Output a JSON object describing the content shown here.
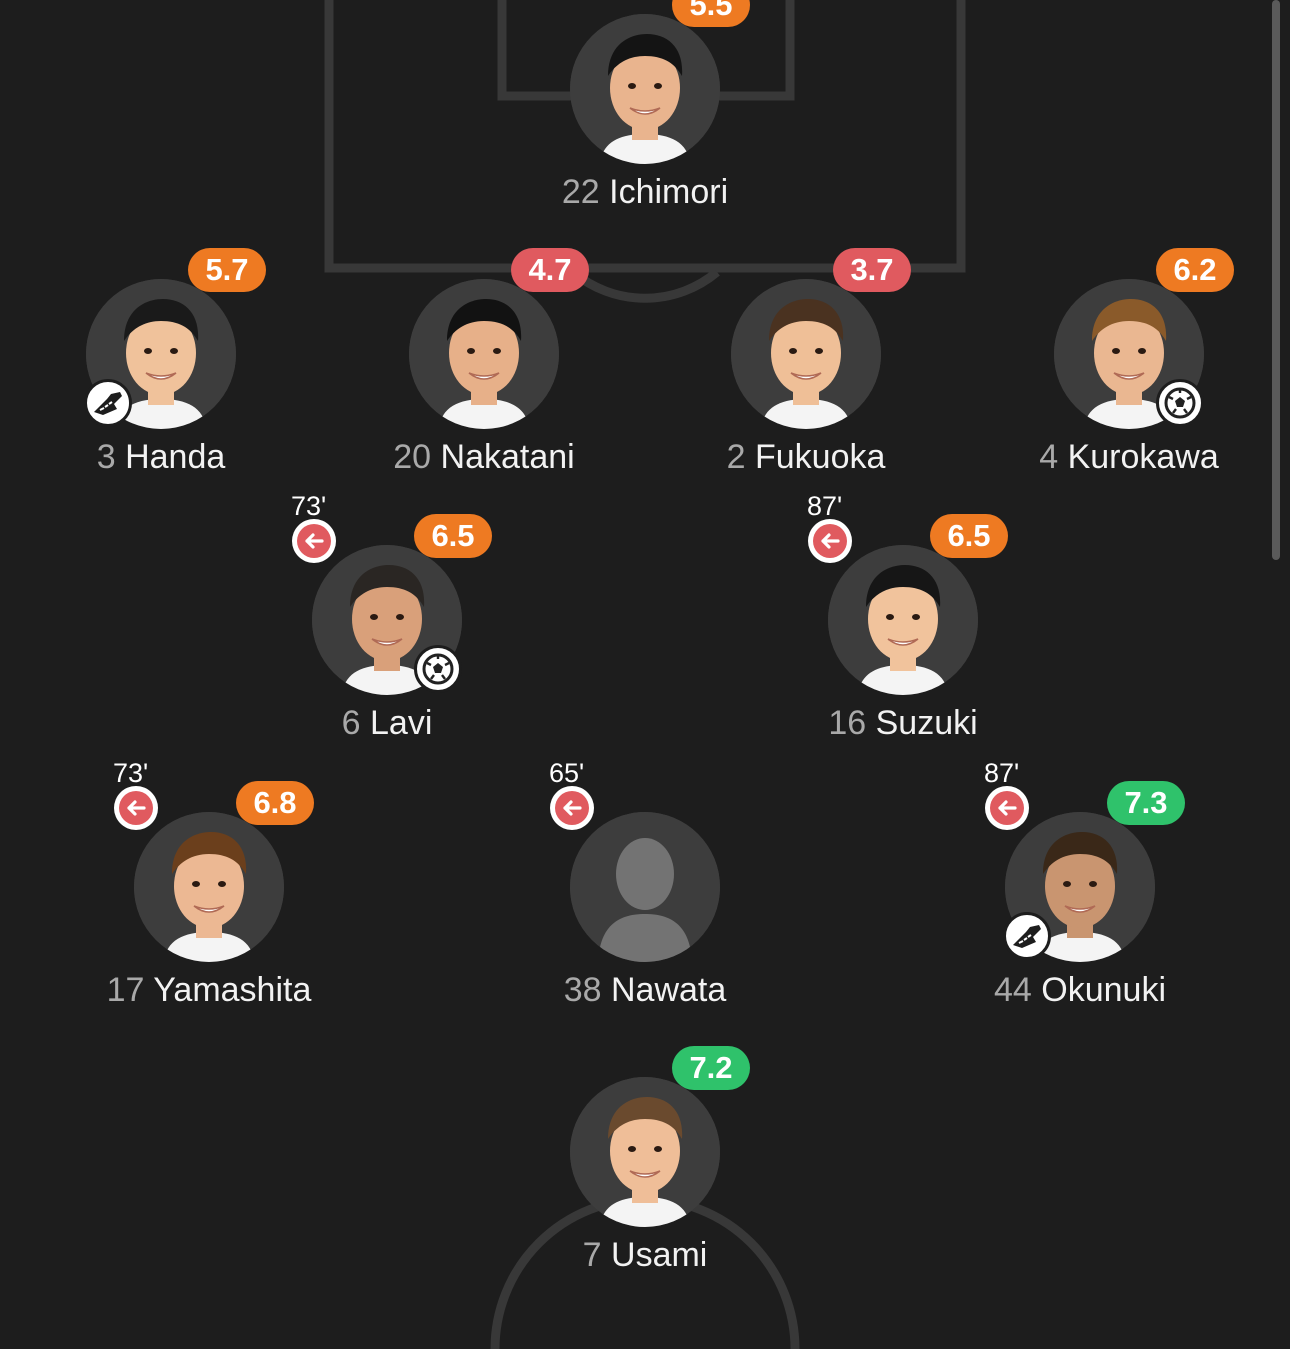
{
  "colors": {
    "background": "#1d1d1d",
    "pitch_line": "#3a3a3a",
    "rating_orange": "#ee7a22",
    "rating_red": "#e05a5f",
    "rating_green": "#2fc26b",
    "sub_red": "#e05a5f"
  },
  "players": [
    {
      "number": "22",
      "name": "Ichimori",
      "rating": "5.5",
      "rating_color": "orange",
      "sub_minute": null,
      "event_icon": null,
      "photo": "player-photo"
    },
    {
      "number": "3",
      "name": "Handa",
      "rating": "5.7",
      "rating_color": "orange",
      "sub_minute": null,
      "event_icon": "boot-icon",
      "photo": "player-photo"
    },
    {
      "number": "20",
      "name": "Nakatani",
      "rating": "4.7",
      "rating_color": "red",
      "sub_minute": null,
      "event_icon": null,
      "photo": "player-photo"
    },
    {
      "number": "2",
      "name": "Fukuoka",
      "rating": "3.7",
      "rating_color": "red",
      "sub_minute": null,
      "event_icon": null,
      "photo": "player-photo"
    },
    {
      "number": "4",
      "name": "Kurokawa",
      "rating": "6.2",
      "rating_color": "orange",
      "sub_minute": null,
      "event_icon": "ball-icon",
      "photo": "player-photo"
    },
    {
      "number": "6",
      "name": "Lavi",
      "rating": "6.5",
      "rating_color": "orange",
      "sub_minute": "73'",
      "event_icon": "ball-icon",
      "photo": "player-photo"
    },
    {
      "number": "16",
      "name": "Suzuki",
      "rating": "6.5",
      "rating_color": "orange",
      "sub_minute": "87'",
      "event_icon": null,
      "photo": "player-photo"
    },
    {
      "number": "17",
      "name": "Yamashita",
      "rating": "6.8",
      "rating_color": "orange",
      "sub_minute": "73'",
      "event_icon": null,
      "photo": "player-photo"
    },
    {
      "number": "38",
      "name": "Nawata",
      "rating": null,
      "rating_color": null,
      "sub_minute": "65'",
      "event_icon": null,
      "photo": "silhouette-placeholder"
    },
    {
      "number": "44",
      "name": "Okunuki",
      "rating": "7.3",
      "rating_color": "green",
      "sub_minute": "87'",
      "event_icon": "boot-icon",
      "photo": "player-photo"
    },
    {
      "number": "7",
      "name": "Usami",
      "rating": "7.2",
      "rating_color": "green",
      "sub_minute": null,
      "event_icon": null,
      "photo": "player-photo"
    }
  ]
}
